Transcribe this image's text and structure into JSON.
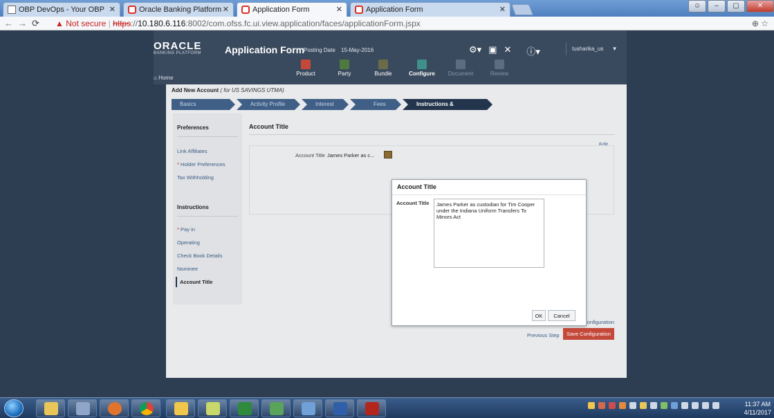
{
  "browser": {
    "tabs": [
      {
        "title": "OBP DevOps - Your OBP",
        "icon": "page-icon"
      },
      {
        "title": "Oracle Banking Platform",
        "icon": "oracle-icon"
      },
      {
        "title": "Application Form",
        "icon": "oracle-icon"
      },
      {
        "title": "Application Form",
        "icon": "oracle-icon"
      }
    ],
    "security_warning": "Not secure",
    "url_scheme": "https",
    "url_sep": "://",
    "url_host": "10.180.6.116",
    "url_path": ":8002/com.ofss.fc.ui.view.application/faces/applicationForm.jspx"
  },
  "header": {
    "logo": "ORACLE",
    "logo_sub": "BANKING PLATFORM",
    "title": "Application Form",
    "posting_label": "Posting Date",
    "posting_date": "15-May-2016",
    "user": "tusharika_us",
    "home": "Home",
    "steps": [
      {
        "label": "Product",
        "color": "#c4493a"
      },
      {
        "label": "Party",
        "color": "#4f7a3f"
      },
      {
        "label": "Bundle",
        "color": "#6b6b4a"
      },
      {
        "label": "Configure",
        "color": "#3f8f8a"
      },
      {
        "label": "Document",
        "color": "#5b6b80"
      },
      {
        "label": "Review",
        "color": "#5b6b80"
      }
    ]
  },
  "form": {
    "heading": "Add New Account",
    "heading_sub": "( for US SAVINGS UTMA)",
    "wizard": [
      "Basics",
      "Activity Profile",
      "Interest",
      "Fees",
      "Instructions & Preferences"
    ],
    "left": {
      "preferences_title": "Preferences",
      "preferences": [
        "Link Affiliates",
        "Holder Preferences",
        "Tax Withholding"
      ],
      "instructions_title": "Instructions",
      "instructions": [
        "Pay in",
        "Operating",
        "Check Book Details",
        "Nominee",
        "Account Title"
      ]
    },
    "section_title": "Account Title",
    "edit": "Edit",
    "account_title_label": "Account Title",
    "account_title_value": "James Parker as c...",
    "cancel_configuration": "Cancel Configuration",
    "previous_step": "Previous Step",
    "save_configuration": "Save Configuration"
  },
  "modal": {
    "title": "Account Title",
    "label": "Account Title",
    "value": "James Parker as custodian for Tim Cooper under the Indiana Uniform Transfers To Minors Act",
    "ok": "OK",
    "cancel": "Cancel"
  },
  "taskbar": {
    "time": "11:37 AM",
    "date": "4/11/2017"
  }
}
